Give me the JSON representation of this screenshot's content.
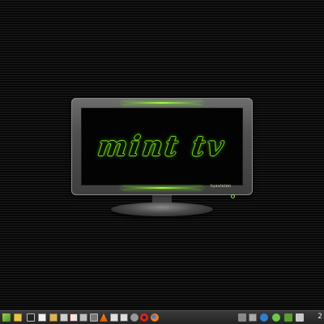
{
  "tv": {
    "screen_text": "mint tv",
    "brand": "tuxvision"
  },
  "taskbar": {
    "launchers": [
      "menu-icon",
      "folder-icon",
      "notes-icon",
      "terminal-icon",
      "text-editor-icon",
      "file-manager-icon",
      "document-viewer-icon",
      "pdf-icon",
      "image-viewer-icon",
      "vlc-icon",
      "browser-icon",
      "calendar-icon",
      "settings-icon",
      "opera-icon",
      "firefox-icon"
    ],
    "tray": [
      "network-icon",
      "monitor-icon",
      "chat-icon",
      "update-icon",
      "volume-icon"
    ],
    "clock": "2"
  }
}
